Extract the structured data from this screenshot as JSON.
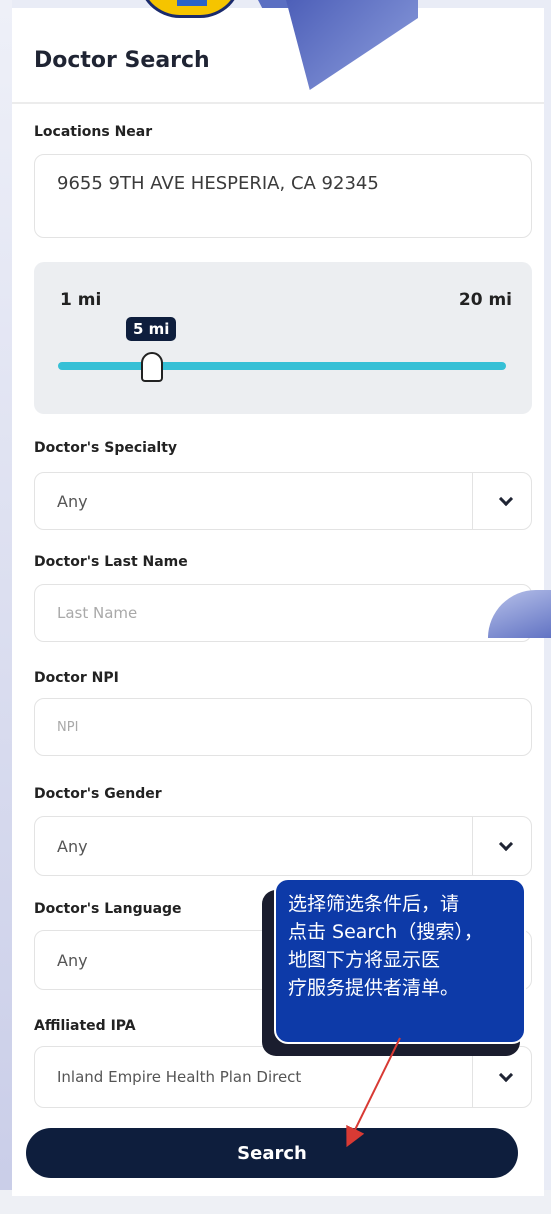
{
  "header": {
    "title": "Doctor Search"
  },
  "location": {
    "label": "Locations Near",
    "value": "9655 9TH AVE HESPERIA, CA 92345"
  },
  "distance": {
    "min_label": "1 mi",
    "max_label": "20 mi",
    "value_label": "5 mi",
    "value_fraction": 0.21
  },
  "specialty": {
    "label": "Doctor's Specialty",
    "value": "Any"
  },
  "last_name": {
    "label": "Doctor's Last Name",
    "placeholder": "Last Name"
  },
  "npi": {
    "label": "Doctor NPI",
    "placeholder": "NPI"
  },
  "gender": {
    "label": "Doctor's Gender",
    "value": "Any"
  },
  "language": {
    "label": "Doctor's Language",
    "value": "Any"
  },
  "ipa": {
    "label": "Affiliated IPA",
    "value": "Inland Empire Health Plan Direct"
  },
  "search_button": {
    "label": "Search"
  },
  "callout": {
    "lines": [
      "选择筛选条件后，请",
      "点击 Search（搜索），",
      "地图下方将显示医",
      "疗服务提供者清单。"
    ]
  },
  "colors": {
    "navy": "#0e1e3d",
    "slider_track": "#36c0d6",
    "callout_blue": "#0d3aa8",
    "arrow_red": "#d83a34"
  }
}
